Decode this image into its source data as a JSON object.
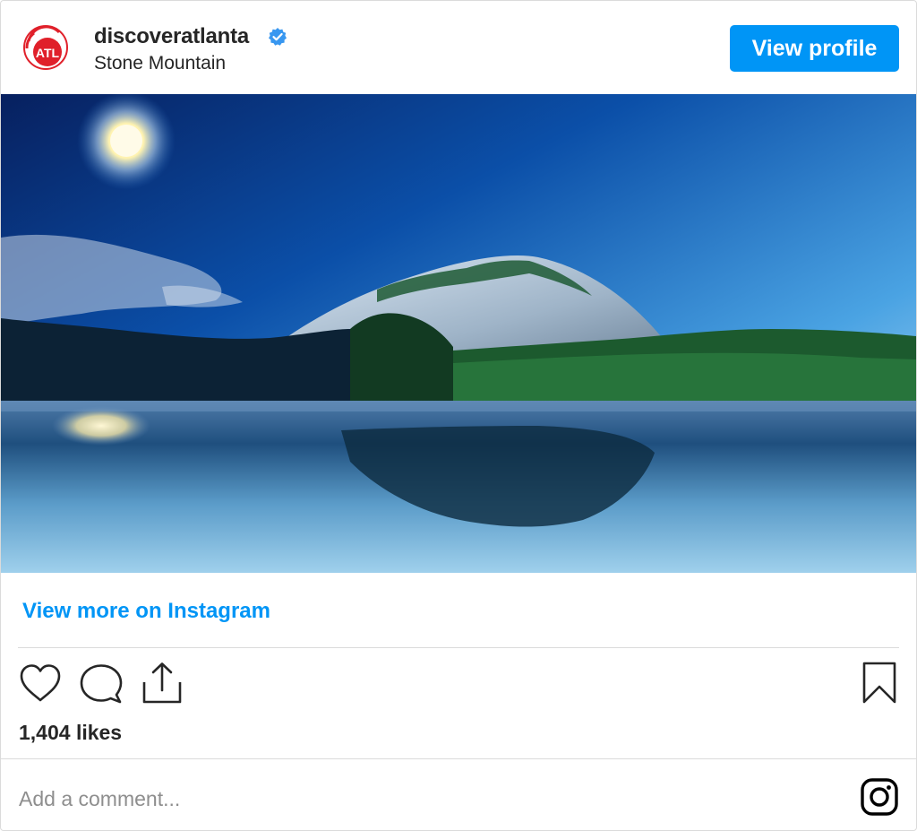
{
  "header": {
    "avatar_text": "ATL",
    "username": "discoveratlanta",
    "location": "Stone Mountain",
    "view_profile_label": "View profile"
  },
  "post": {
    "image_icon": "photo-stone-mountain",
    "view_more_label": "View more on Instagram",
    "likes": "1,404 likes"
  },
  "actions": {
    "like_icon": "heart-icon",
    "comment_icon": "comment-icon",
    "share_icon": "share-icon",
    "save_icon": "bookmark-icon"
  },
  "comment": {
    "placeholder": "Add a comment..."
  },
  "colors": {
    "accent": "#0095f6",
    "brand_red": "#e0202a",
    "text": "#262626",
    "border": "#dbdbdb"
  }
}
